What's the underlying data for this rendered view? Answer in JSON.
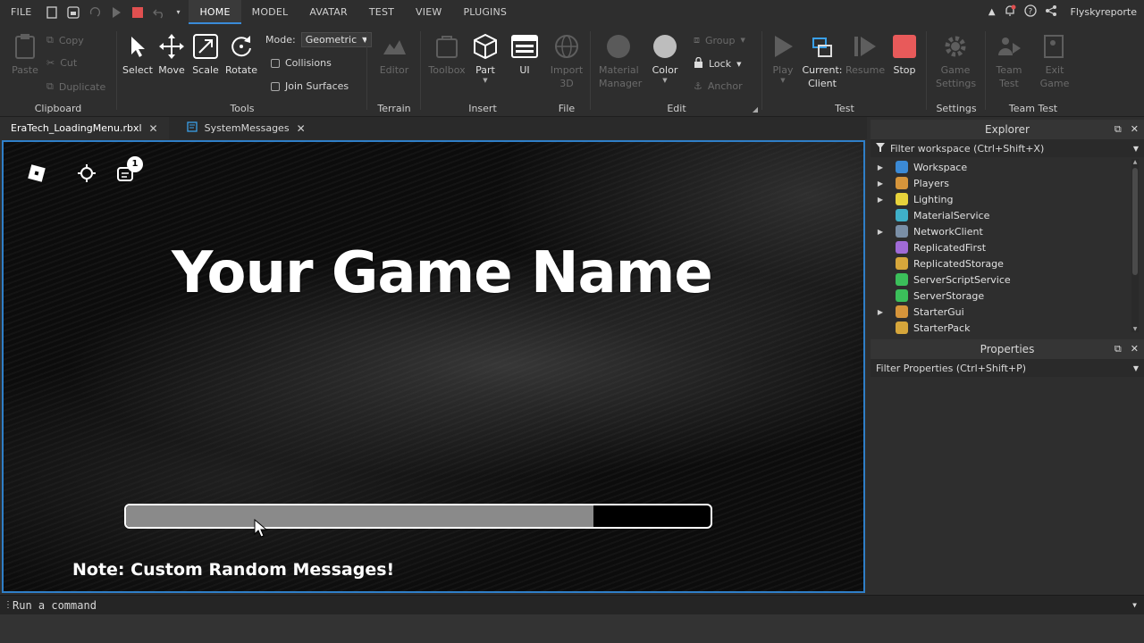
{
  "menubar": {
    "file": "FILE",
    "tabs": [
      "HOME",
      "MODEL",
      "AVATAR",
      "TEST",
      "VIEW",
      "PLUGINS"
    ],
    "active_tab": "HOME",
    "username": "Flyskyreporte"
  },
  "ribbon": {
    "clipboard": {
      "label": "Clipboard",
      "paste": "Paste",
      "copy": "Copy",
      "cut": "Cut",
      "duplicate": "Duplicate"
    },
    "tools": {
      "label": "Tools",
      "select": "Select",
      "move": "Move",
      "scale": "Scale",
      "rotate": "Rotate",
      "mode_label": "Mode:",
      "mode_value": "Geometric",
      "collisions": "Collisions",
      "join_surfaces": "Join Surfaces"
    },
    "terrain": {
      "label": "Terrain",
      "editor": "Editor"
    },
    "insert": {
      "label": "Insert",
      "toolbox": "Toolbox",
      "part": "Part",
      "ui": "UI"
    },
    "file": {
      "label": "File",
      "import3d_line1": "Import",
      "import3d_line2": "3D"
    },
    "edit": {
      "label": "Edit",
      "material_line1": "Material",
      "material_line2": "Manager",
      "color": "Color",
      "group": "Group",
      "lock": "Lock",
      "anchor": "Anchor"
    },
    "test": {
      "label": "Test",
      "play": "Play",
      "current_line1": "Current:",
      "current_line2": "Client",
      "resume": "Resume",
      "stop": "Stop"
    },
    "settings": {
      "label": "Settings",
      "game_line1": "Game",
      "game_line2": "Settings"
    },
    "team_test": {
      "label": "Team Test",
      "team_line1": "Team",
      "team_line2": "Test",
      "exit_line1": "Exit",
      "exit_line2": "Game"
    }
  },
  "tabs": [
    {
      "label": "EraTech_LoadingMenu.rbxl"
    },
    {
      "label": "SystemMessages"
    }
  ],
  "viewport": {
    "notification_count": "1",
    "game_title": "Your Game Name",
    "loading_progress": 0.8,
    "note": "Note: Custom Random Messages!"
  },
  "explorer": {
    "title": "Explorer",
    "filter_placeholder": "Filter workspace (Ctrl+Shift+X)",
    "items": [
      {
        "label": "Workspace",
        "expandable": true,
        "color": "#3b8ad6"
      },
      {
        "label": "Players",
        "expandable": true,
        "color": "#d6953b"
      },
      {
        "label": "Lighting",
        "expandable": true,
        "color": "#e6d23b"
      },
      {
        "label": "MaterialService",
        "expandable": false,
        "color": "#3fb0c8"
      },
      {
        "label": "NetworkClient",
        "expandable": true,
        "color": "#7a8fa6"
      },
      {
        "label": "ReplicatedFirst",
        "expandable": false,
        "color": "#a06ad6"
      },
      {
        "label": "ReplicatedStorage",
        "expandable": false,
        "color": "#d6a63b"
      },
      {
        "label": "ServerScriptService",
        "expandable": false,
        "color": "#3bbf5a"
      },
      {
        "label": "ServerStorage",
        "expandable": false,
        "color": "#3bbf5a"
      },
      {
        "label": "StarterGui",
        "expandable": true,
        "color": "#d6953b"
      },
      {
        "label": "StarterPack",
        "expandable": false,
        "color": "#d6a63b"
      }
    ]
  },
  "properties": {
    "title": "Properties",
    "filter_placeholder": "Filter Properties (Ctrl+Shift+P)"
  },
  "command_bar": {
    "placeholder": "Run a command"
  }
}
